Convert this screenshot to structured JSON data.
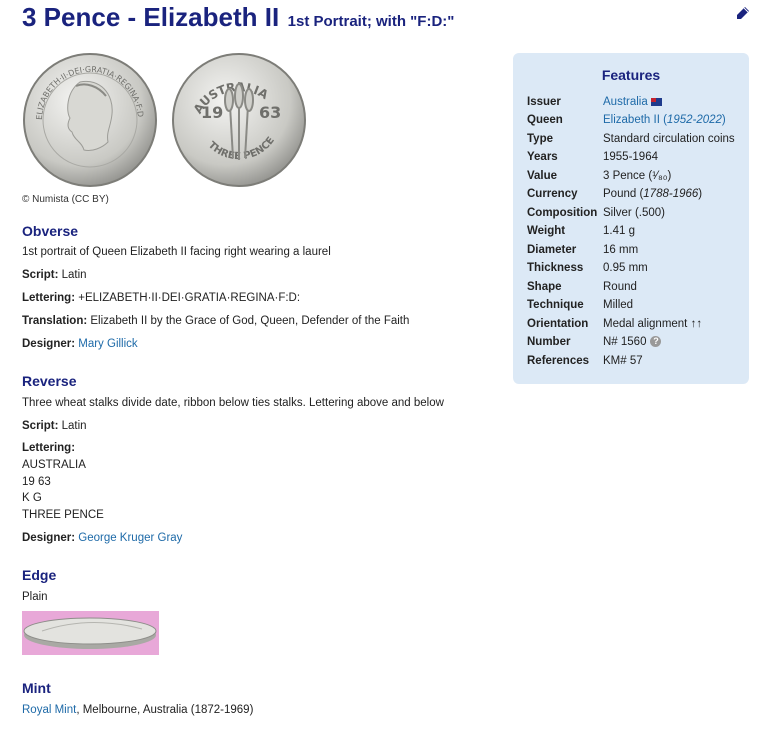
{
  "header": {
    "title": "3 Pence - Elizabeth II",
    "subtitle": "1st Portrait; with \"F:D:\""
  },
  "credit": "© Numista (CC BY)",
  "obverse": {
    "heading": "Obverse",
    "description": "1st portrait of Queen Elizabeth II facing right wearing a laurel",
    "script_label": "Script:",
    "script_value": "Latin",
    "lettering_label": "Lettering:",
    "lettering_value": "+ELIZABETH·II·DEI·GRATIA·REGINA·F:D:",
    "translation_label": "Translation:",
    "translation_value": "Elizabeth II by the Grace of God, Queen, Defender of the Faith",
    "designer_label": "Designer:",
    "designer_value": "Mary Gillick"
  },
  "reverse": {
    "heading": "Reverse",
    "description": "Three wheat stalks divide date, ribbon below ties stalks. Lettering above and below",
    "script_label": "Script:",
    "script_value": "Latin",
    "lettering_label": "Lettering:",
    "lettering_lines": [
      "AUSTRALIA",
      "19 63",
      "K G",
      "THREE PENCE"
    ],
    "designer_label": "Designer:",
    "designer_value": "George Kruger Gray"
  },
  "edge": {
    "heading": "Edge",
    "value": "Plain"
  },
  "mint": {
    "heading": "Mint",
    "link": "Royal Mint",
    "rest": ", Melbourne, Australia (1872-1969)"
  },
  "features": {
    "heading": "Features",
    "rows": [
      {
        "key": "Issuer",
        "value": "Australia"
      },
      {
        "key": "Queen",
        "value": "Elizabeth II (",
        "italic": "1952-2022",
        "tail": ")"
      },
      {
        "key": "Type",
        "value": "Standard circulation coins"
      },
      {
        "key": "Years",
        "value": "1955-1964"
      },
      {
        "key": "Value",
        "value": "3 Pence (¹⁄₈₀)"
      },
      {
        "key": "Currency",
        "value": "Pound (",
        "italic": "1788-1966",
        "tail": ")"
      },
      {
        "key": "Composition",
        "value": "Silver (.500)"
      },
      {
        "key": "Weight",
        "value": "1.41 g"
      },
      {
        "key": "Diameter",
        "value": "16 mm"
      },
      {
        "key": "Thickness",
        "value": "0.95 mm"
      },
      {
        "key": "Shape",
        "value": "Round"
      },
      {
        "key": "Technique",
        "value": "Milled"
      },
      {
        "key": "Orientation",
        "value": "Medal alignment ↑↑"
      },
      {
        "key": "Number",
        "value": "N# 1560"
      },
      {
        "key": "References",
        "value": "KM# 57"
      }
    ]
  },
  "coin_obverse_text": "ELIZABETH·II·DEI·GRATIA·REGINA·F:D",
  "coin_reverse": {
    "top": "AUSTRALIA",
    "left": "19",
    "right": "63",
    "bottom": "THREE PENCE"
  },
  "colors": {
    "heading": "#1a237e",
    "link": "#1e6aa8",
    "panel": "#dce9f6"
  }
}
